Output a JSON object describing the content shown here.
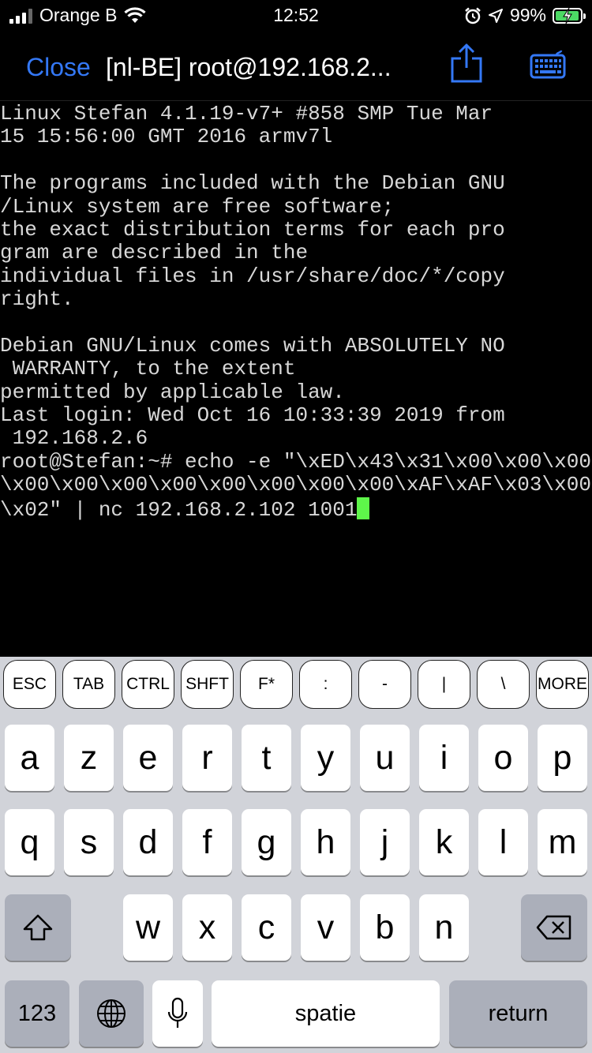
{
  "status_bar": {
    "carrier": "Orange B",
    "time": "12:52",
    "battery": "99%",
    "icons": [
      "signal-icon",
      "wifi-icon",
      "alarm-icon",
      "location-icon",
      "battery-charging-icon"
    ]
  },
  "nav": {
    "close_label": "Close",
    "title": "[nl-BE] root@192.168.2...",
    "accent_color": "#3478f6"
  },
  "terminal": {
    "lines": [
      "Linux Stefan 4.1.19-v7+ #858 SMP Tue Mar",
      "15 15:56:00 GMT 2016 armv7l",
      "",
      "The programs included with the Debian GNU",
      "/Linux system are free software;",
      "the exact distribution terms for each pro",
      "gram are described in the",
      "individual files in /usr/share/doc/*/copy",
      "right.",
      "",
      "Debian GNU/Linux comes with ABSOLUTELY NO",
      " WARRANTY, to the extent",
      "permitted by applicable law.",
      "Last login: Wed Oct 16 10:33:39 2019 from",
      " 192.168.2.6",
      "root@Stefan:~# echo -e \"\\xED\\x43\\x31\\x00\\x00\\x00",
      "\\x00\\x00\\x00\\x00\\x00\\x00\\x00\\x00\\xAF\\xAF\\x03\\x00",
      "\\x02\" | nc 192.168.2.102 1001"
    ],
    "cursor_color": "#5ef64a"
  },
  "accessory_keys": [
    "ESC",
    "TAB",
    "CTRL",
    "SHFT",
    "F*",
    ":",
    "-",
    "|",
    "\\",
    "MORE"
  ],
  "keyboard": {
    "row1": [
      "a",
      "z",
      "e",
      "r",
      "t",
      "y",
      "u",
      "i",
      "o",
      "p"
    ],
    "row2": [
      "q",
      "s",
      "d",
      "f",
      "g",
      "h",
      "j",
      "k",
      "l",
      "m"
    ],
    "row3": [
      "w",
      "x",
      "c",
      "v",
      "b",
      "n"
    ],
    "numbers_label": "123",
    "space_label": "spatie",
    "return_label": "return"
  }
}
